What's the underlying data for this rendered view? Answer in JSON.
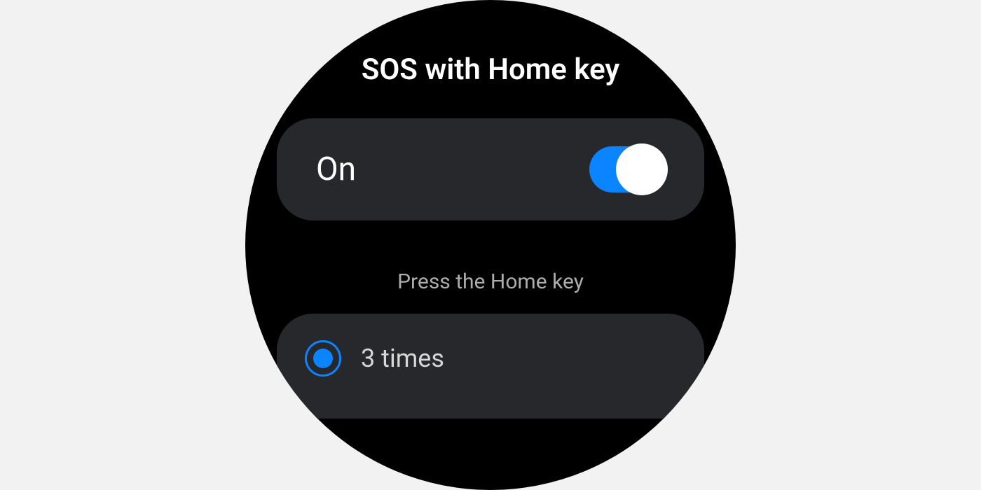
{
  "header": {
    "title": "SOS with Home key"
  },
  "toggle": {
    "label": "On",
    "state": true
  },
  "section": {
    "label": "Press the Home key"
  },
  "options": [
    {
      "label": "3 times",
      "selected": true
    }
  ],
  "colors": {
    "accent": "#0a84ff",
    "card": "#26282b",
    "background": "#000000"
  }
}
